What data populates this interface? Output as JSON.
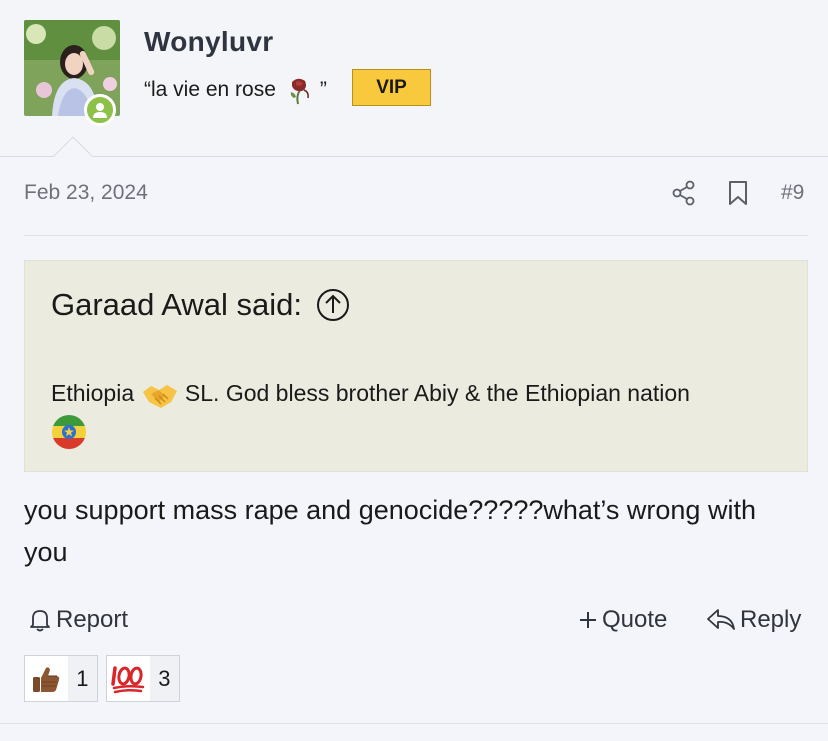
{
  "user": {
    "name": "Wonyluvr",
    "title_prefix": "“la vie en rose",
    "title_suffix": "”",
    "badge": "VIP",
    "online": true
  },
  "post": {
    "date": "Feb 23, 2024",
    "number": "#9",
    "quote": {
      "author_label": "Garaad Awal said:",
      "text_part1": "Ethiopia",
      "text_part2": "SL. God bless brother Abiy & the Ethiopian nation"
    },
    "body": "you support mass rape and genocide?????what’s wrong with you"
  },
  "actions": {
    "report": "Report",
    "quote": "Quote",
    "reply": "Reply"
  },
  "reactions": [
    {
      "emoji": "thumbs-up",
      "count": "1"
    },
    {
      "emoji": "hundred-points",
      "count": "3"
    }
  ],
  "icons": {
    "share": "share-icon",
    "bookmark": "bookmark-icon",
    "jump": "jump-to-quote-icon",
    "bell": "bell-icon",
    "plus": "plus-icon",
    "reply": "reply-icon"
  },
  "colors": {
    "vip_badge": "#f9c93d",
    "online": "#8dc14a",
    "quote_bg": "#ebebe0",
    "page_bg": "#f4f5fa"
  }
}
